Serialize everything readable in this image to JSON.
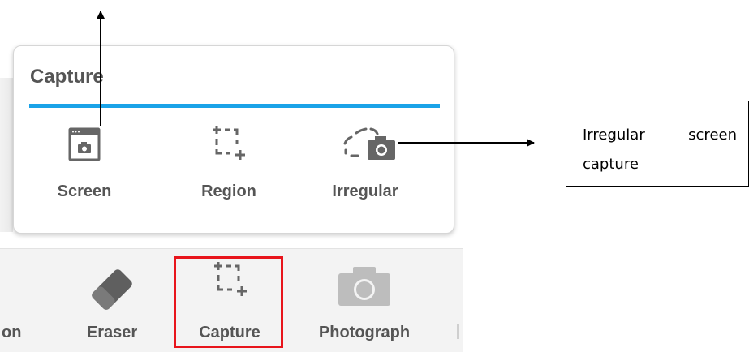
{
  "capture_panel": {
    "title": "Capture",
    "accent_color": "#1aa3e8",
    "options": [
      {
        "label": "Screen",
        "icon": "screen-camera-icon"
      },
      {
        "label": "Region",
        "icon": "region-select-icon"
      },
      {
        "label": "Irregular",
        "icon": "irregular-select-icon"
      }
    ]
  },
  "toolbar": {
    "items": [
      {
        "label": "on",
        "icon": "none"
      },
      {
        "label": "Eraser",
        "icon": "eraser-icon"
      },
      {
        "label": "Capture",
        "icon": "region-select-icon",
        "highlighted": true,
        "highlight_color": "#e8141b"
      },
      {
        "label": "Photograph",
        "icon": "camera-icon"
      }
    ]
  },
  "annotations": {
    "callout_text": "Irregular screen capture"
  }
}
